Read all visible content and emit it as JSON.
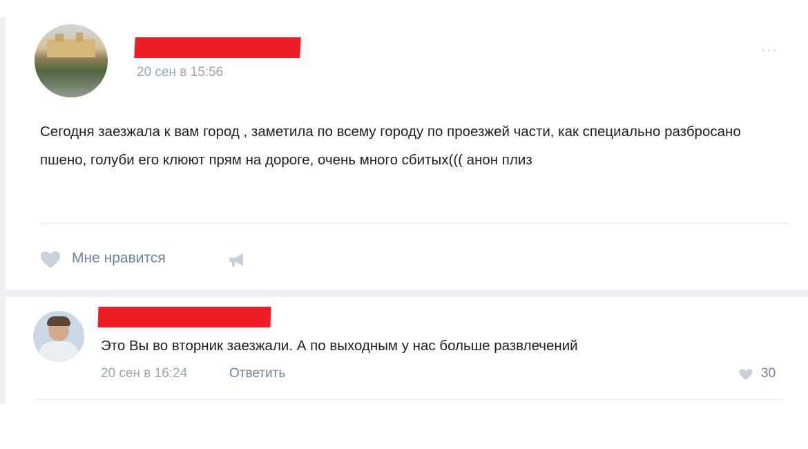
{
  "post": {
    "date": "20 сен в 15:56",
    "more": "...",
    "text": "Сегодня заезжала к вам город , заметила по всему городу по проезжей части, как специально разбросано пшено, голуби его клюют прям на дороге, очень много сбитых((( анон плиз",
    "like_label": "Мне нравится",
    "icons": {
      "like": "heart-icon",
      "share": "megaphone-icon"
    }
  },
  "comment": {
    "text": "Это Вы во вторник заезжали. А по выходным у нас больше развлечений",
    "date": "20 сен в 16:24",
    "reply_label": "Ответить",
    "like_count": "30",
    "icons": {
      "like": "heart-icon"
    }
  },
  "colors": {
    "redaction": "#ef1d25",
    "link": "#6f8399",
    "meta": "#9aa4ae",
    "divider": "#e4e7eb"
  }
}
